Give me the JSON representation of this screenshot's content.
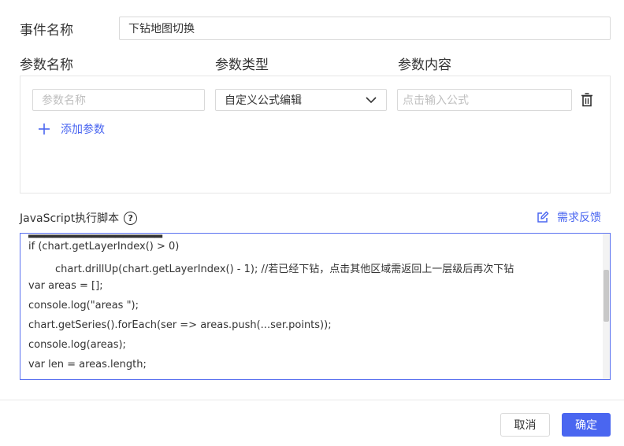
{
  "event": {
    "name_label": "事件名称",
    "name_value": "下钻地图切换"
  },
  "params": {
    "headers": {
      "name": "参数名称",
      "type": "参数类型",
      "content": "参数内容"
    },
    "row": {
      "name_placeholder": "参数名称",
      "type_value": "自定义公式编辑",
      "content_placeholder": "点击输入公式"
    },
    "add_label": "添加参数"
  },
  "script": {
    "label": "JavaScript执行脚本",
    "help_icon_text": "?",
    "feedback_label": "需求反馈",
    "lines": [
      "if (chart.getLayerIndex() > 0)",
      "chart.drillUp(chart.getLayerIndex() - 1); //若已经下钻，点击其他区域需返回上一层级后再次下钻",
      "var areas = [];",
      "console.log(\"areas \");",
      "chart.getSeries().forEach(ser => areas.push(...ser.points));",
      "console.log(areas);",
      "var len = areas.length;"
    ]
  },
  "footer": {
    "cancel_label": "取消",
    "confirm_label": "确定"
  },
  "colors": {
    "accent": "#4a66f0",
    "border": "#d9d9d9",
    "text": "#333333",
    "placeholder": "#bfbfbf"
  },
  "icons": {
    "delete": "trash-icon",
    "add": "plus-icon",
    "help": "question-circle-icon",
    "feedback": "edit-icon",
    "select": "chevron-down-icon"
  }
}
